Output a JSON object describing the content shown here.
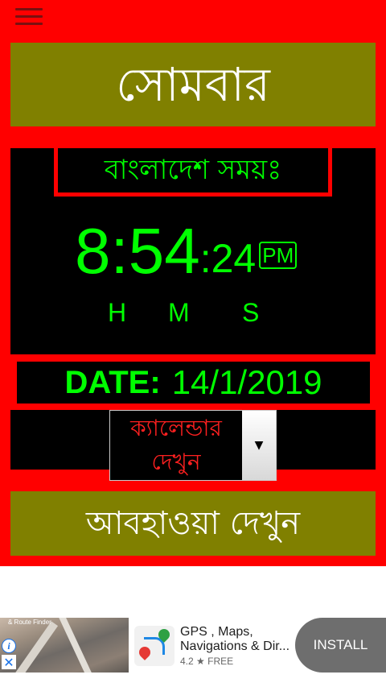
{
  "app": {
    "day_of_week": "সোমবার",
    "timezone_label": "বাংলাদেশ সময়ঃ",
    "time": {
      "hours": "8",
      "minutes": "54",
      "seconds": "24",
      "ampm": "PM",
      "sep": ":"
    },
    "time_labels": {
      "h": "H",
      "m": "M",
      "s": "S"
    },
    "date": {
      "label": "DATE:",
      "value": "14/1/2019"
    },
    "calendar_select": {
      "text": "ক্যালেন্ডার দেখুন",
      "arrow": "▼"
    },
    "weather_button": "আবহাওয়া দেখুন"
  },
  "ad": {
    "image_caption": "& Route Finder",
    "title": "GPS , Maps, Navigations & Dir...",
    "rating": "4.2 ★ FREE",
    "install_label": "INSTALL",
    "info_icon": "i",
    "close_icon": "✕"
  },
  "colors": {
    "app_background": "#ff0000",
    "panel_olive": "#808000",
    "panel_black": "#000000",
    "clock_green": "#00ff00",
    "install_button": "#6e6e6e"
  },
  "icons": {
    "menu": "hamburger-menu-icon",
    "dropdown": "chevron-down-icon",
    "ad_info": "info-icon",
    "ad_close": "close-icon",
    "ad_app": "map-pin-icon"
  }
}
